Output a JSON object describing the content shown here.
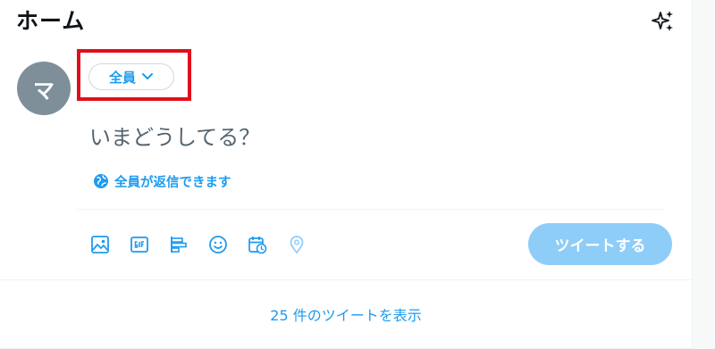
{
  "header": {
    "title": "ホーム",
    "sparkle_icon": "sparkle-icon"
  },
  "composer": {
    "avatar_initial": "マ",
    "audience_label": "全員",
    "placeholder": "いまどうしてる？",
    "reply_setting": "全員が返信できます",
    "tweet_button": "ツイートする",
    "toolbar_icons": [
      "image-icon",
      "gif-icon",
      "poll-icon",
      "emoji-icon",
      "schedule-icon",
      "location-icon"
    ]
  },
  "timeline": {
    "show_more": "25 件のツイートを表示"
  },
  "colors": {
    "accent": "#1d9bf0",
    "button_disabled": "#8ecdf8",
    "highlight": "#e0101a",
    "avatar_bg": "#7e8f9a"
  }
}
